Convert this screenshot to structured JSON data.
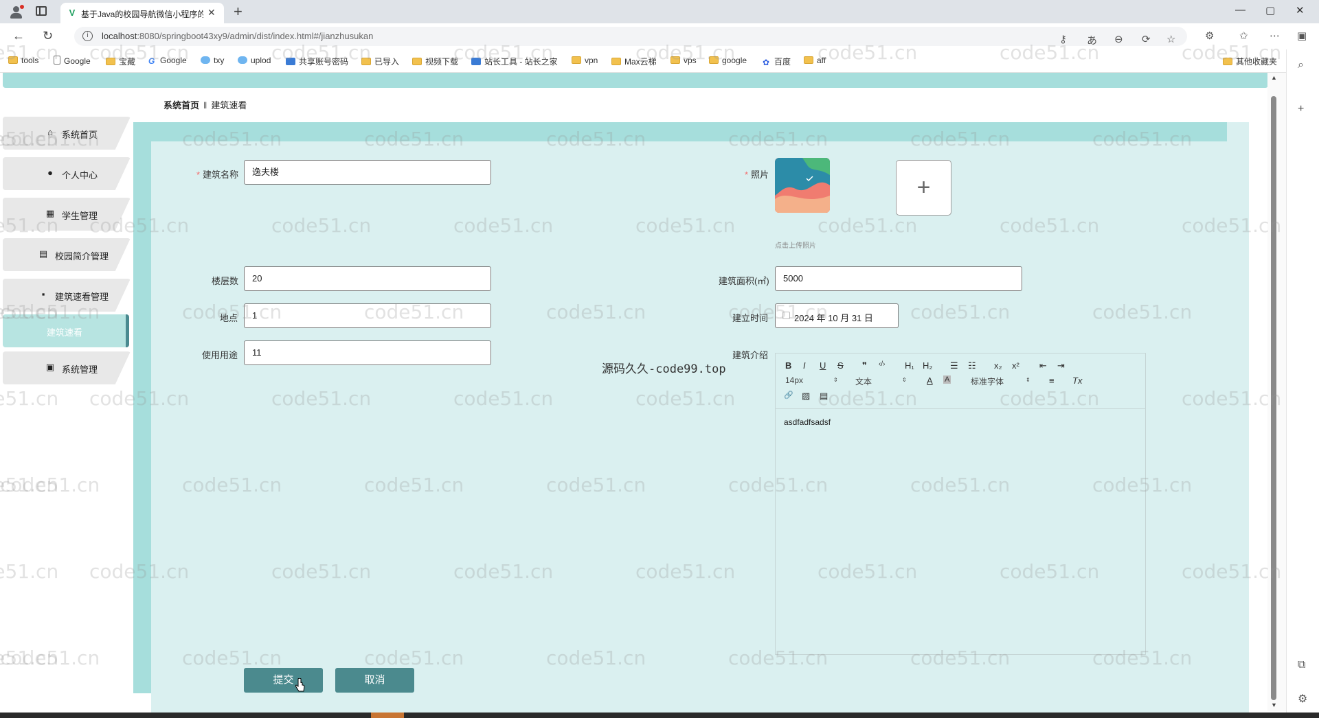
{
  "browser": {
    "tab_title": "基于Java的校园导航微信小程序的",
    "tab_close": "✕",
    "new_tab": "+",
    "window_controls": [
      "—",
      "▢",
      "✕"
    ],
    "url_host": "localhost",
    "url_rest": ":8080/springboot43xy9/admin/dist/index.html#/jianzhusukan",
    "bookmarks": [
      {
        "label": "tools",
        "icon": "folder"
      },
      {
        "label": "Google",
        "icon": "page"
      },
      {
        "label": "宝藏",
        "icon": "folder"
      },
      {
        "label": "Google",
        "icon": "g"
      },
      {
        "label": "txy",
        "icon": "cloud"
      },
      {
        "label": "uplod",
        "icon": "cloud"
      },
      {
        "label": "共享账号密码",
        "icon": "blue"
      },
      {
        "label": "已导入",
        "icon": "folder"
      },
      {
        "label": "视频下载",
        "icon": "folder"
      },
      {
        "label": "站长工具 - 站长之家",
        "icon": "blue"
      },
      {
        "label": "vpn",
        "icon": "folder"
      },
      {
        "label": "Max云梯",
        "icon": "folder"
      },
      {
        "label": "vps",
        "icon": "folder"
      },
      {
        "label": "google",
        "icon": "folder"
      },
      {
        "label": "百度",
        "icon": "bd"
      },
      {
        "label": "aff",
        "icon": "folder"
      }
    ],
    "other_bookmarks": "其他收藏夹"
  },
  "breadcrumb": {
    "home": "系统首页",
    "separator": "‖",
    "current": "建筑速看"
  },
  "sidebar": {
    "items": [
      {
        "label": "系统首页",
        "icon": "⌂"
      },
      {
        "label": "个人中心",
        "icon": "●"
      },
      {
        "label": "学生管理",
        "icon": "▦"
      },
      {
        "label": "校园简介管理",
        "icon": "▤"
      },
      {
        "label": "建筑速看管理",
        "icon": "▪"
      },
      {
        "label": "建筑速看",
        "icon": ""
      },
      {
        "label": "系统管理",
        "icon": "▣"
      }
    ]
  },
  "form": {
    "name_label": "建筑名称",
    "name_value": "逸夫楼",
    "photo_label": "照片",
    "photo_add": "+",
    "photo_hint": "点击上传照片",
    "floors_label": "楼层数",
    "floors_value": "20",
    "area_label": "建筑面积(㎡)",
    "area_value": "5000",
    "location_label": "地点",
    "location_value": "1",
    "built_label": "建立时间",
    "built_value": "2024 年 10 月 31 日",
    "usage_label": "使用用途",
    "usage_value": "11",
    "intro_label": "建筑介绍",
    "intro_content": "asdfadfsadsf"
  },
  "editor": {
    "row1": [
      "B",
      "I",
      "U",
      "S",
      "❞",
      "‹/›",
      "H₁",
      "H₂",
      "☰",
      "☷",
      "x₂",
      "x²",
      "⇤",
      "⇥"
    ],
    "size": "14px",
    "text_type": "文本",
    "font": "标准字体",
    "row2_icons": [
      "A",
      "A",
      "≡",
      "Tx"
    ],
    "row3_icons": [
      "🔗",
      "▨",
      "▤"
    ]
  },
  "overlay_text": "源码久久-code99.top",
  "buttons": {
    "submit": "提交",
    "cancel": "取消"
  },
  "watermark": "code51.cn",
  "colors": {
    "teal_light": "#a6dedc",
    "teal_bg": "#daf0f0",
    "button": "#4b8a8e",
    "required": "#f56c6c"
  }
}
